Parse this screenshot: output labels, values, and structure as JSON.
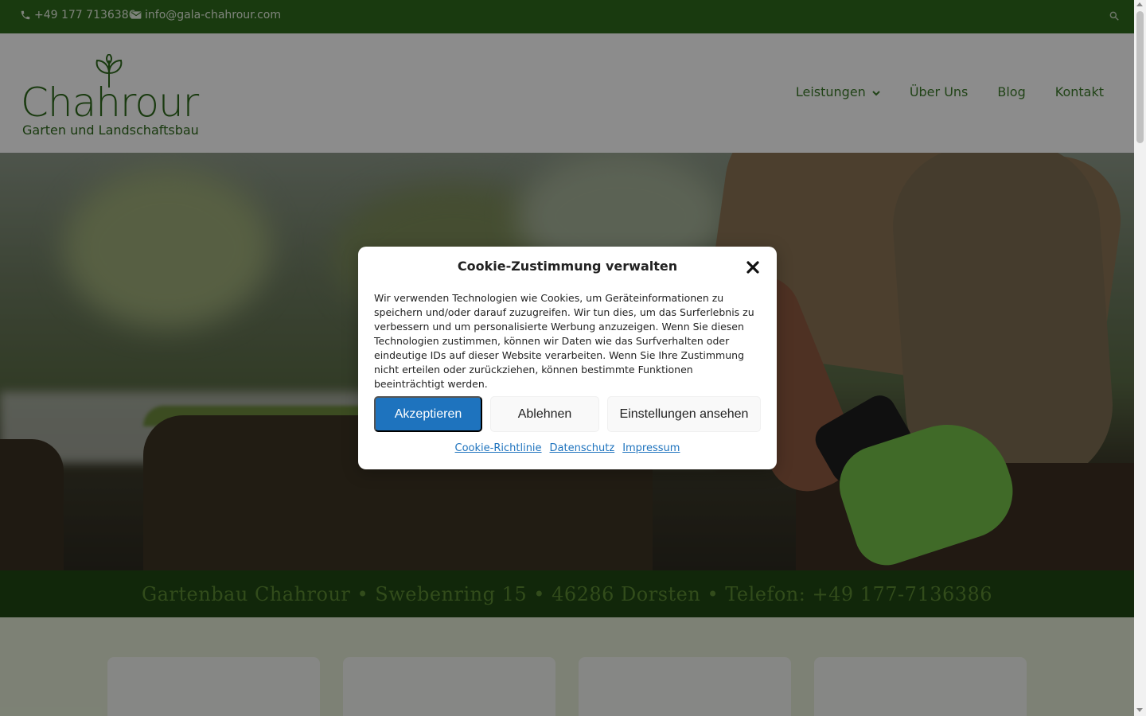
{
  "topbar": {
    "phone": "+49 177 7136386",
    "email": "info@gala-chahrour.com",
    "icons": [
      "phone-icon",
      "mail-icon",
      "search-icon"
    ]
  },
  "header": {
    "logo_word": "Chahrour",
    "logo_sub": "Garten und Landschaftsbau",
    "nav": [
      {
        "label": "Leistungen",
        "has_dropdown": true
      },
      {
        "label": "Über Uns"
      },
      {
        "label": "Blog"
      },
      {
        "label": "Kontakt"
      }
    ]
  },
  "band": {
    "text": "Gartenbau Chahrour • Swebenring 15 • 46286 Dorsten • Telefon: +49 177-7136386"
  },
  "cookie_modal": {
    "title": "Cookie-Zustimmung verwalten",
    "body": "Wir verwenden Technologien wie Cookies, um Geräteinformationen zu speichern und/oder darauf zuzugreifen. Wir tun dies, um das Surferlebnis zu verbessern und um personalisierte Werbung anzuzeigen. Wenn Sie diesen Technologien zustimmen, können wir Daten wie das Surfverhalten oder eindeutige IDs auf dieser Website verarbeiten. Wenn Sie Ihre Zustimmung nicht erteilen oder zurückziehen, können bestimmte Funktionen beeinträchtigt werden.",
    "accept_label": "Akzeptieren",
    "deny_label": "Ablehnen",
    "prefs_label": "Einstellungen ansehen",
    "links": [
      "Cookie-Richtlinie",
      "Datenschutz",
      "Impressum"
    ]
  },
  "colors": {
    "brand_green": "#2f6a1c",
    "band_green": "#1f4713",
    "accept_blue": "#1e73be"
  }
}
